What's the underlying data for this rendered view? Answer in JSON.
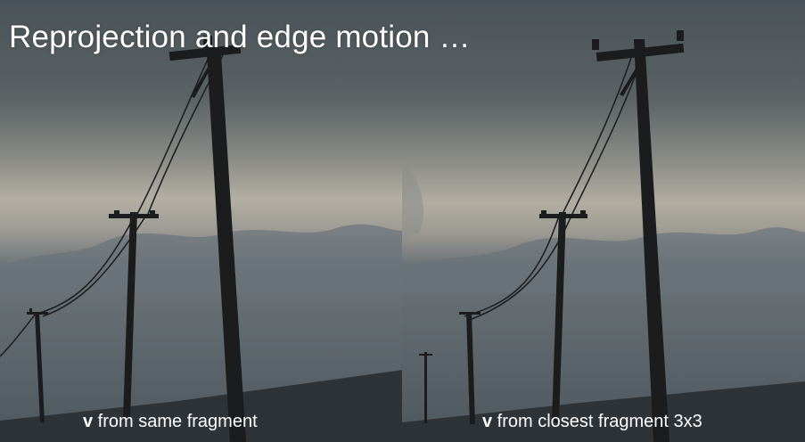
{
  "slide": {
    "title": "Reprojection and edge motion …"
  },
  "panels": [
    {
      "caption_var": "v",
      "caption_rest": " from same fragment"
    },
    {
      "caption_var": "v",
      "caption_rest": " from closest fragment 3x3"
    }
  ],
  "colors": {
    "sky_top": "#4a5359",
    "sky_band": "#b3afa3",
    "sky_low": "#5c676e",
    "ground": "#2e3338",
    "pole": "#1a1c1d",
    "text": "#ffffff"
  }
}
